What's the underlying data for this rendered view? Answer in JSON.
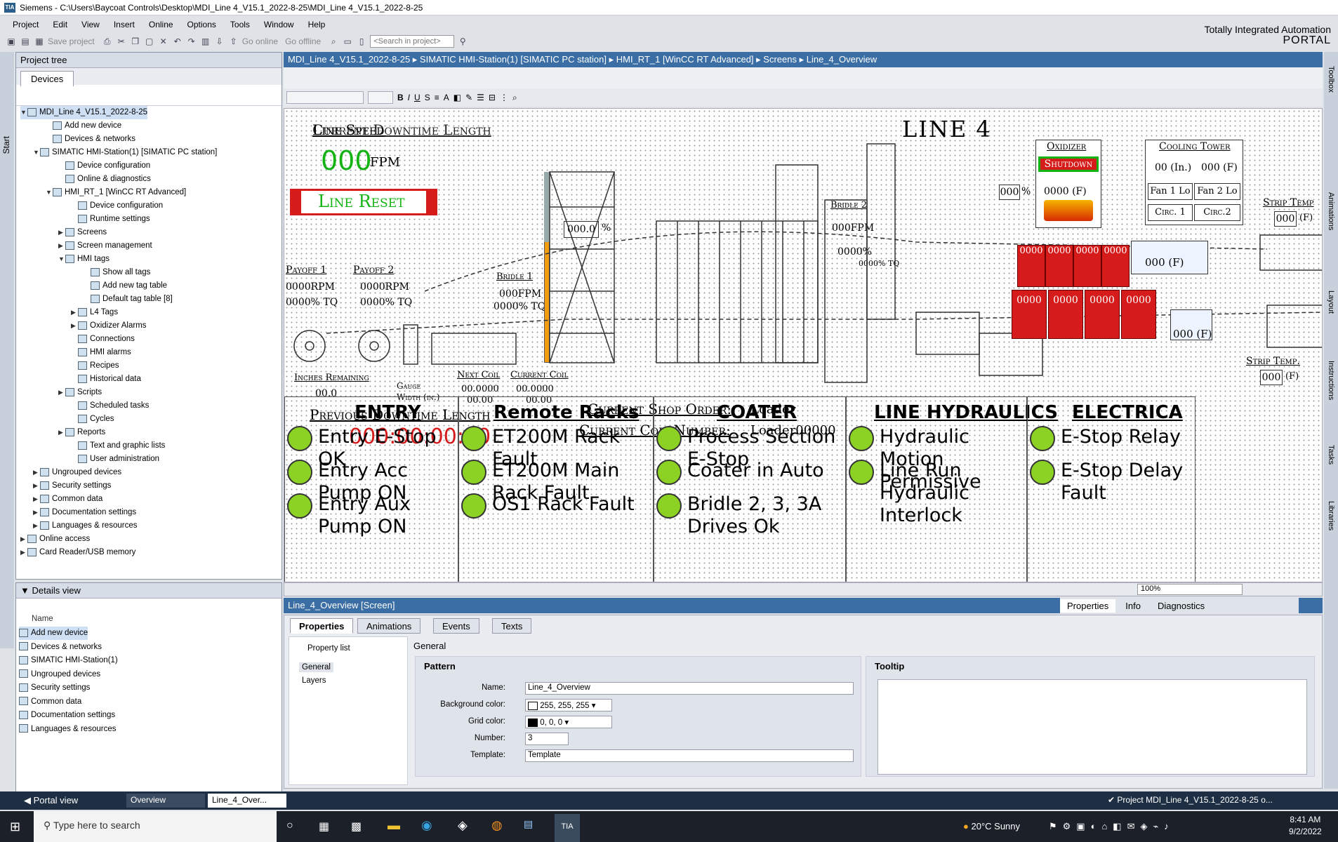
{
  "window": {
    "title": "Siemens  -  C:\\Users\\Baycoat Controls\\Desktop\\MDI_Line 4_V15.1_2022-8-25\\MDI_Line 4_V15.1_2022-8-25",
    "logo": "TIA"
  },
  "brand": {
    "line1": "Totally Integrated Automation",
    "line2": "PORTAL"
  },
  "menu": [
    "Project",
    "Edit",
    "View",
    "Insert",
    "Online",
    "Options",
    "Tools",
    "Window",
    "Help"
  ],
  "toolbar": {
    "save_project": "Save project",
    "go_online": "Go online",
    "go_offline": "Go offline",
    "search_placeholder": "<Search in project>"
  },
  "project_tree": {
    "title": "Project tree",
    "tab": "Devices",
    "side_label": "Start",
    "items": [
      {
        "label": "MDI_Line 4_V15.1_2022-8-25",
        "indent": 0,
        "arrow": "▼"
      },
      {
        "label": "Add new device",
        "indent": 2,
        "arrow": ""
      },
      {
        "label": "Devices & networks",
        "indent": 2,
        "arrow": ""
      },
      {
        "label": "SIMATIC HMI-Station(1) [SIMATIC PC station]",
        "indent": 1,
        "arrow": "▼"
      },
      {
        "label": "Device configuration",
        "indent": 3,
        "arrow": ""
      },
      {
        "label": "Online & diagnostics",
        "indent": 3,
        "arrow": ""
      },
      {
        "label": "HMI_RT_1 [WinCC RT Advanced]",
        "indent": 2,
        "arrow": "▼"
      },
      {
        "label": "Device configuration",
        "indent": 4,
        "arrow": ""
      },
      {
        "label": "Runtime settings",
        "indent": 4,
        "arrow": ""
      },
      {
        "label": "Screens",
        "indent": 3,
        "arrow": "▶"
      },
      {
        "label": "Screen management",
        "indent": 3,
        "arrow": "▶"
      },
      {
        "label": "HMI tags",
        "indent": 3,
        "arrow": "▼"
      },
      {
        "label": "Show all tags",
        "indent": 5,
        "arrow": ""
      },
      {
        "label": "Add new tag table",
        "indent": 5,
        "arrow": ""
      },
      {
        "label": "Default tag table [8]",
        "indent": 5,
        "arrow": ""
      },
      {
        "label": "L4 Tags",
        "indent": 4,
        "arrow": "▶"
      },
      {
        "label": "Oxidizer Alarms",
        "indent": 4,
        "arrow": "▶"
      },
      {
        "label": "Connections",
        "indent": 4,
        "arrow": ""
      },
      {
        "label": "HMI alarms",
        "indent": 4,
        "arrow": ""
      },
      {
        "label": "Recipes",
        "indent": 4,
        "arrow": ""
      },
      {
        "label": "Historical data",
        "indent": 4,
        "arrow": ""
      },
      {
        "label": "Scripts",
        "indent": 3,
        "arrow": "▶"
      },
      {
        "label": "Scheduled tasks",
        "indent": 4,
        "arrow": ""
      },
      {
        "label": "Cycles",
        "indent": 4,
        "arrow": ""
      },
      {
        "label": "Reports",
        "indent": 3,
        "arrow": "▶"
      },
      {
        "label": "Text and graphic lists",
        "indent": 4,
        "arrow": ""
      },
      {
        "label": "User administration",
        "indent": 4,
        "arrow": ""
      },
      {
        "label": "Ungrouped devices",
        "indent": 1,
        "arrow": "▶"
      },
      {
        "label": "Security settings",
        "indent": 1,
        "arrow": "▶"
      },
      {
        "label": "Common data",
        "indent": 1,
        "arrow": "▶"
      },
      {
        "label": "Documentation settings",
        "indent": 1,
        "arrow": "▶"
      },
      {
        "label": "Languages & resources",
        "indent": 1,
        "arrow": "▶"
      },
      {
        "label": "Online access",
        "indent": 0,
        "arrow": "▶"
      },
      {
        "label": "Card Reader/USB memory",
        "indent": 0,
        "arrow": "▶"
      }
    ]
  },
  "details_view": {
    "title": "Details view",
    "column": "Name",
    "items": [
      "Add new device",
      "Devices & networks",
      "SIMATIC HMI-Station(1)",
      "Ungrouped devices",
      "Security settings",
      "Common data",
      "Documentation settings",
      "Languages & resources"
    ]
  },
  "editor": {
    "breadcrumb": "MDI_Line 4_V15.1_2022-8-25  ▸  SIMATIC HMI-Station(1) [SIMATIC PC station]  ▸  HMI_RT_1 [WinCC RT Advanced]  ▸  Screens  ▸  Line_4_Overview",
    "zoom": "100%"
  },
  "hmi": {
    "line_title": "LINE 4",
    "line_speed_label": "Line Speed",
    "current_downtime_label": "Current Downtime Length",
    "speed_value": "000",
    "speed_unit": "FPM",
    "line_reset": "Line Reset",
    "payoff1": {
      "label": "Payoff 1",
      "rpm": "0000RPM",
      "tq": "0000% TQ"
    },
    "payoff2": {
      "label": "Payoff 2",
      "rpm": "0000RPM",
      "tq": "0000% TQ"
    },
    "bridle1": {
      "label": "Bridle 1",
      "fpm": "000FPM",
      "tq": "0000% TQ"
    },
    "bridle2": {
      "label": "Bridle 2",
      "fpm": "000FPM",
      "tq": "0000% TQ",
      "pct": "0000%"
    },
    "accum_value": "000.0",
    "accum_unit": "%",
    "inches_remaining_label": "Inches Remaining",
    "inches_remaining": "00.0",
    "gauge_label1": "Gauge",
    "gauge_label2": "Width (in.)",
    "next_coil_label": "Next Coil",
    "next_coil_1": "00.0000",
    "next_coil_2": "00.00",
    "current_coil_label": "Current Coil",
    "current_coil_1": "00.0000",
    "current_coil_2": "00.00",
    "previous_downtime_label": "Previous Downtime Length",
    "previous_downtime": "000:00:00:00",
    "shop_order_label": "Current Shop Order:",
    "shop_order": "Loader",
    "coil_number_label": "Current Coil Number:",
    "coil_number": "Loader00000",
    "oxidizer": {
      "title": "Oxidizer",
      "status": "Shutdown",
      "temp": "0000 (F)",
      "pct": "000"
    },
    "cooling_tower": {
      "title": "Cooling Tower",
      "level": "00 (In.)",
      "temp": "000 (F)",
      "fan1": "Fan 1 Lo",
      "fan2": "Fan 2 Lo",
      "circ1": "Circ. 1",
      "circ2": "Circ.2"
    },
    "strip_temp1": {
      "label": "Strip Temp",
      "value": "000",
      "unit": "(F)"
    },
    "strip_temp2": {
      "label": "Strip Temp.",
      "value": "000",
      "unit": "(F)"
    },
    "oven1_zones": [
      "0000",
      "0000",
      "0000",
      "0000"
    ],
    "oven2_zones": [
      "0000",
      "0000",
      "0000",
      "0000"
    ],
    "quench1": "000 (F)",
    "quench2": "000 (F)"
  },
  "panels": [
    {
      "title": "ENTRY",
      "items": [
        "Entry E-Stop OK",
        "Entry Acc Pump ON",
        "Entry Aux Pump ON"
      ]
    },
    {
      "title": "Remote Racks",
      "items": [
        "ET200M Rack Fault",
        "ET200M Main Rack Fault",
        "OS1 Rack Fault"
      ]
    },
    {
      "title": "COATER",
      "items": [
        "Process Section E-Stop",
        "Coater in Auto",
        "Bridle 2, 3, 3A Drives Ok"
      ]
    },
    {
      "title": "LINE HYDRAULICS",
      "items": [
        "Hydraulic Motion Permissive",
        "Line Run Hydraulic Interlock"
      ]
    },
    {
      "title": "ELECTRICA",
      "items": [
        "E-Stop Relay",
        "E-Stop Delay Fault"
      ]
    }
  ],
  "properties": {
    "header": "Line_4_Overview [Screen]",
    "right_tabs": [
      "Properties",
      "Info",
      "Diagnostics"
    ],
    "tabs": [
      "Properties",
      "Animations",
      "Events",
      "Texts"
    ],
    "nav": {
      "title": "Property list",
      "items": [
        "General",
        "Layers"
      ]
    },
    "section": "General",
    "pattern_title": "Pattern",
    "tooltip_title": "Tooltip",
    "name_label": "Name:",
    "name": "Line_4_Overview",
    "bg_label": "Background color:",
    "bg": "255, 255, 255",
    "grid_label": "Grid color:",
    "grid": "0, 0, 0",
    "number_label": "Number:",
    "number": "3",
    "template_label": "Template:",
    "template": "Template"
  },
  "right_sidebar": [
    "Toolbox",
    "Animations",
    "Layout",
    "Instructions",
    "Tasks",
    "Libraries"
  ],
  "portal": {
    "portal_view": "Portal view",
    "tab1": "Overview",
    "tab2": "Line_4_Over...",
    "status": "Project MDI_Line 4_V15.1_2022-8-25 o..."
  },
  "taskbar": {
    "search": "Type here to search",
    "weather_temp": "20°C",
    "weather": "Sunny",
    "time": "8:41 AM",
    "date": "9/2/2022"
  },
  "colors": {
    "accent": "#3a6ea5",
    "green": "#8bd225",
    "red": "#d61b1b",
    "digit_green": "#12b312"
  }
}
